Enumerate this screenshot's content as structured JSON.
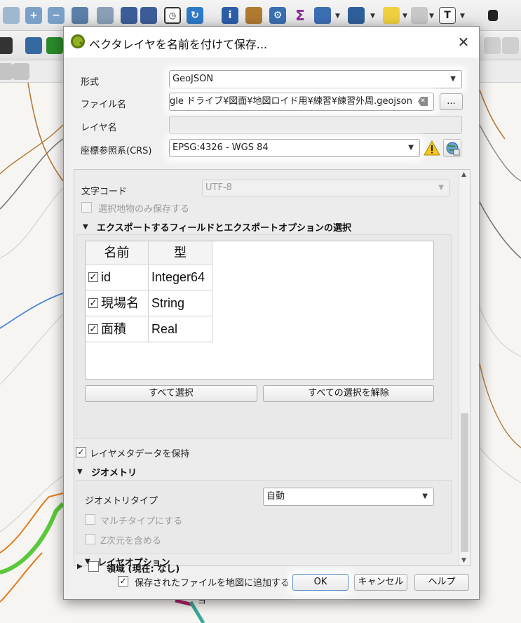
{
  "dialog": {
    "title": "ベクタレイヤを名前を付けて保存...",
    "close_glyph": "✕",
    "format_label": "形式",
    "format_value": "GeoJSON",
    "filename_label": "ファイル名",
    "filename_value": "gle ドライブ¥図面¥地図ロイド用¥練習¥練習外周.geojson",
    "browse_label": "...",
    "layername_label": "レイヤ名",
    "layername_value": "",
    "crs_label": "座標参照系(CRS)",
    "crs_value": "EPSG:4326 - WGS 84",
    "encoding_label": "文字コード",
    "encoding_value": "UTF-8",
    "selected_only_label": "選択地物のみ保存する",
    "fields_section_label": "エクスポートするフィールドとエクスポートオプションの選択",
    "fields_table": {
      "headers": [
        "名前",
        "型"
      ],
      "rows": [
        {
          "name": "id",
          "type": "Integer64",
          "checked": true
        },
        {
          "name": "現場名",
          "type": "String",
          "checked": true
        },
        {
          "name": "面積",
          "type": "Real",
          "checked": true
        }
      ]
    },
    "select_all_label": "すべて選択",
    "deselect_all_label": "すべての選択を解除",
    "keep_metadata_label": "レイヤメタデータを保持",
    "geometry_section_label": "ジオメトリ",
    "geometry_type_label": "ジオメトリタイプ",
    "geometry_type_value": "自動",
    "multitype_label": "マルチタイプにする",
    "z_dimension_label": "Z次元を含める",
    "extent_section_label": "領域 (現在: なし)",
    "layer_options_section_label": "レイヤオプション",
    "add_to_map_label": "保存されたファイルを地図に追加する",
    "ok_label": "OK",
    "cancel_label": "キャンセル",
    "help_label": "ヘルプ"
  },
  "background": {
    "map_label_a": "ヨ"
  },
  "colors": {
    "accent_green": "#6ab023",
    "qgis_green": "#93b023",
    "warning_yellow": "#f5c518"
  }
}
